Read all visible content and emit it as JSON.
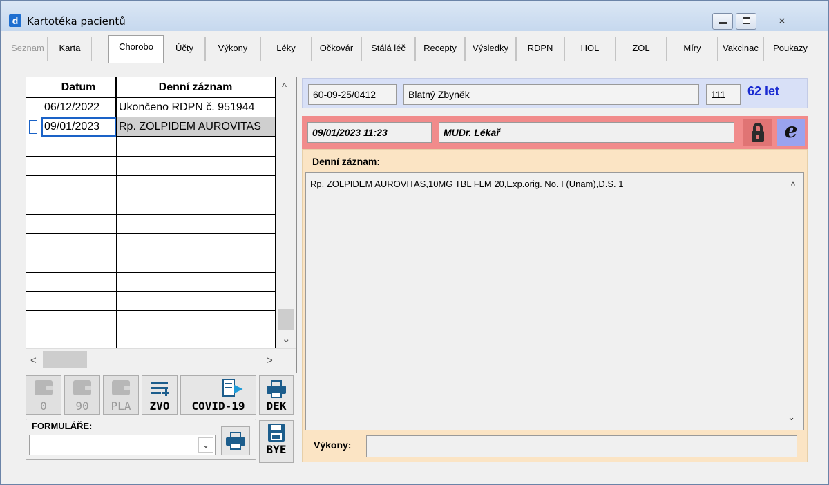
{
  "window": {
    "title": "Kartotéka pacientů",
    "app_icon": "d",
    "close_glyph": "✕"
  },
  "tabs": [
    {
      "label": "Seznam",
      "state": "disabled"
    },
    {
      "label": "Karta",
      "state": "normal"
    },
    {
      "label": "Chorobo",
      "state": "active"
    },
    {
      "label": "Účty",
      "state": "normal"
    },
    {
      "label": "Výkony",
      "state": "normal"
    },
    {
      "label": "Léky",
      "state": "normal"
    },
    {
      "label": "Očkovár",
      "state": "normal"
    },
    {
      "label": "Stálá léč",
      "state": "normal"
    },
    {
      "label": "Recepty",
      "state": "normal"
    },
    {
      "label": "Výsledky",
      "state": "normal"
    },
    {
      "label": "RDPN",
      "state": "normal"
    },
    {
      "label": "HOL",
      "state": "normal"
    },
    {
      "label": "ZOL",
      "state": "normal"
    },
    {
      "label": "Míry",
      "state": "normal"
    },
    {
      "label": "Vakcinac",
      "state": "normal"
    },
    {
      "label": "Poukazy",
      "state": "normal"
    }
  ],
  "grid": {
    "headers": [
      "Datum",
      "Denní záznam"
    ],
    "rows": [
      {
        "date": "06/12/2022",
        "entry": "Ukončeno RDPN č. 951944"
      },
      {
        "date": "09/01/2023",
        "entry": "Rp. ZOLPIDEM AUROVITAS"
      }
    ],
    "scroll_up": "^",
    "scroll_down": "⌄",
    "scroll_left": "<",
    "scroll_right": ">"
  },
  "toolbar": {
    "buttons": [
      {
        "label": "0",
        "enabled": false
      },
      {
        "label": "90",
        "enabled": false
      },
      {
        "label": "PLA",
        "enabled": false
      },
      {
        "label": "ZVO",
        "enabled": true
      },
      {
        "label": "COVID-19",
        "enabled": true
      },
      {
        "label": "DEK",
        "enabled": true
      }
    ],
    "forms_label": "FORMULÁŘE:",
    "forms_value": "",
    "bye_label": "BYE"
  },
  "patient": {
    "birth_number": "60-09-25/0412",
    "name": "Blatný Zbyněk",
    "insurance": "111",
    "age": "62 let"
  },
  "record": {
    "datetime": "09/01/2023 11:23",
    "doctor": "MUDr. Lékař",
    "e_label": "e",
    "label": "Denní záznam:",
    "text": "Rp. ZOLPIDEM AUROVITAS,10MG TBL FLM 20,Exp.orig. No. I (Unam),D.S. 1",
    "vykony_label": "Výkony:",
    "vykony_value": ""
  }
}
